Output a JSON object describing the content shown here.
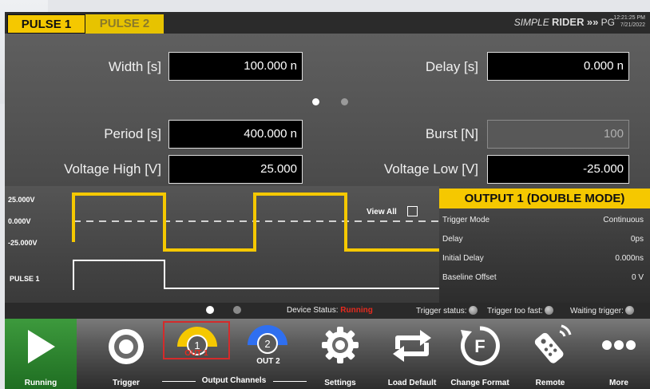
{
  "tabs": [
    {
      "label": "PULSE 1",
      "active": true
    },
    {
      "label": "PULSE 2",
      "active": false
    }
  ],
  "header": {
    "brand_italic": "SIMPLE",
    "brand_bold": "RIDER",
    "brand_arrows": "»»",
    "brand_suffix": "PG",
    "time": "12:21:25 PM",
    "date": "7/21/2022"
  },
  "params": {
    "width": {
      "label": "Width [s]",
      "value": "100.000 n"
    },
    "delay": {
      "label": "Delay [s]",
      "value": "0.000 n"
    },
    "period": {
      "label": "Period [s]",
      "value": "400.000 n"
    },
    "burst": {
      "label": "Burst [N]",
      "value": "100"
    },
    "vhigh": {
      "label": "Voltage High [V]",
      "value": "25.000"
    },
    "vlow": {
      "label": "Voltage Low [V]",
      "value": "-25.000"
    },
    "page_indicator": {
      "count": 2,
      "active": 0
    }
  },
  "waveform": {
    "level_high": "25.000V",
    "level_zero": "0.000V",
    "level_low": "-25.000V",
    "pulse_label": "PULSE 1",
    "view_all_label": "View All",
    "view_all_checked": false
  },
  "output_info": {
    "title": "OUTPUT 1 (DOUBLE MODE)",
    "rows": [
      {
        "key": "Trigger Mode",
        "value": "Continuous"
      },
      {
        "key": "Delay",
        "value": "0ps"
      },
      {
        "key": "Initial Delay",
        "value": "0.000ns"
      },
      {
        "key": "Baseline Offset",
        "value": "0 V"
      }
    ]
  },
  "status": {
    "device_status_label": "Device Status:",
    "device_status_value": "Running",
    "trigger_status_label": "Trigger status:",
    "trigger_too_fast_label": "Trigger too fast:",
    "waiting_trigger_label": "Waiting trigger:"
  },
  "toolbar": {
    "running_label": "Running",
    "trigger_label": "Trigger",
    "out1_number": "1",
    "out1_label": "OUT 1",
    "out2_number": "2",
    "out2_label": "OUT 2",
    "output_channels_label": "Output Channels",
    "settings_label": "Settings",
    "load_default_label": "Load Default",
    "change_format_label": "Change Format",
    "change_format_glyph": "F",
    "remote_label": "Remote",
    "more_label": "More"
  },
  "colors": {
    "accent_yellow": "#f5c800",
    "running_green": "#2e8b34",
    "status_red": "#e52a1f",
    "out2_blue": "#2f6ff0"
  }
}
